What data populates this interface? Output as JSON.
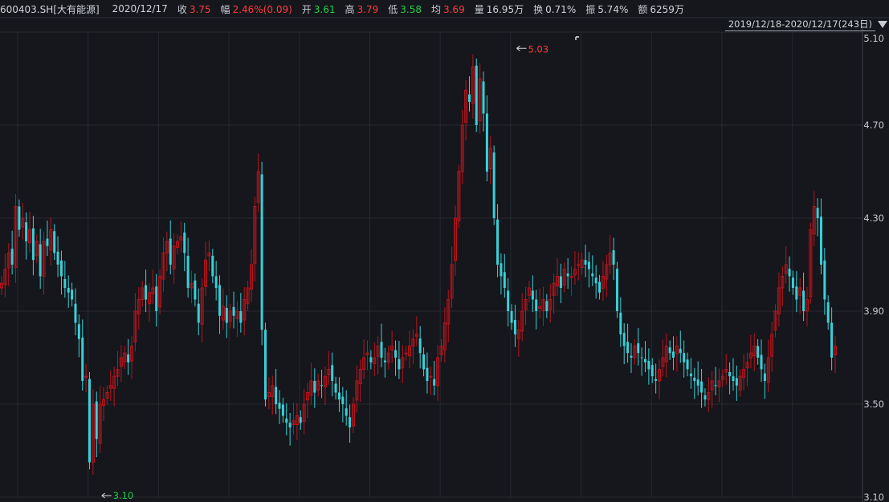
{
  "header": {
    "code": "600403.SH[大有能源]",
    "date": "2020/12/17",
    "close": {
      "label": "收",
      "value": "3.75"
    },
    "change": {
      "label": "幅",
      "value": "2.46%(0.09)"
    },
    "open": {
      "label": "开",
      "value": "3.61"
    },
    "high": {
      "label": "高",
      "value": "3.79"
    },
    "low": {
      "label": "低",
      "value": "3.58"
    },
    "avg": {
      "label": "均",
      "value": "3.69"
    },
    "volume": {
      "label": "量",
      "value": "16.95万"
    },
    "turnover": {
      "label": "换",
      "value": "0.71%"
    },
    "amplitude": {
      "label": "振",
      "value": "5.74%"
    },
    "amount": {
      "label": "额",
      "value": "6259万"
    }
  },
  "range_label": "2019/12/18-2020/12/17(243日)",
  "colors": {
    "up": "#ff3b3b",
    "down": "#39d0d8",
    "up_candle": "#b8141c",
    "grid": "#262a31",
    "background": "#15171c"
  },
  "chart_data": {
    "type": "candlestick",
    "title": "",
    "period": "2019/12/18-2020/12/17",
    "y_ticks": [
      "3.10",
      "3.50",
      "3.90",
      "4.30",
      "4.70",
      "5.10"
    ],
    "ylim": [
      3.1,
      5.1
    ],
    "grid": true,
    "max_marker": {
      "value": "5.03",
      "index": 146
    },
    "min_marker": {
      "value": "3.10",
      "index": 28
    },
    "close_series": [
      4.02,
      4.08,
      4.15,
      4.1,
      4.35,
      4.25,
      4.3,
      4.2,
      4.25,
      4.12,
      4.2,
      4.05,
      4.2,
      4.18,
      4.25,
      4.15,
      4.1,
      4.05,
      4.0,
      3.98,
      3.95,
      3.85,
      3.78,
      3.6,
      3.62,
      3.25,
      3.5,
      3.35,
      3.5,
      3.52,
      3.55,
      3.58,
      3.62,
      3.65,
      3.7,
      3.72,
      3.68,
      3.75,
      3.9,
      3.95,
      4.0,
      3.95,
      3.98,
      4.0,
      3.9,
      4.05,
      4.15,
      4.2,
      4.1,
      4.18,
      4.2,
      4.22,
      4.15,
      4.0,
      4.02,
      3.95,
      3.85,
      4.0,
      4.12,
      4.15,
      4.05,
      4.0,
      3.88,
      3.92,
      3.85,
      3.9,
      3.88,
      3.9,
      3.85,
      3.95,
      4.0,
      4.1,
      4.35,
      4.5,
      3.82,
      3.52,
      3.55,
      3.58,
      3.5,
      3.48,
      3.45,
      3.42,
      3.4,
      3.43,
      3.45,
      3.42,
      3.5,
      3.55,
      3.6,
      3.55,
      3.6,
      3.58,
      3.62,
      3.65,
      3.6,
      3.55,
      3.52,
      3.5,
      3.45,
      3.4,
      3.5,
      3.6,
      3.65,
      3.7,
      3.72,
      3.68,
      3.7,
      3.75,
      3.7,
      3.68,
      3.72,
      3.75,
      3.7,
      3.65,
      3.7,
      3.72,
      3.75,
      3.78,
      3.8,
      3.72,
      3.65,
      3.6,
      3.62,
      3.58,
      3.7,
      3.75,
      3.85,
      3.95,
      4.1,
      4.3,
      4.5,
      4.7,
      4.85,
      4.8,
      4.95,
      4.7,
      4.9,
      4.75,
      4.5,
      4.6,
      4.3,
      4.1,
      4.05,
      4.0,
      3.9,
      3.85,
      3.8,
      3.82,
      3.9,
      3.95,
      4.0,
      3.95,
      3.9,
      3.92,
      3.95,
      3.9,
      3.95,
      4.02,
      4.05,
      4.0,
      4.08,
      4.05,
      4.05,
      4.08,
      4.1,
      4.12,
      4.1,
      4.08,
      4.05,
      4.02,
      3.98,
      4.05,
      4.1,
      4.15,
      4.1,
      3.9,
      3.8,
      3.75,
      3.72,
      3.7,
      3.75,
      3.72,
      3.7,
      3.68,
      3.65,
      3.62,
      3.6,
      3.65,
      3.7,
      3.75,
      3.72,
      3.7,
      3.75,
      3.72,
      3.68,
      3.65,
      3.62,
      3.6,
      3.58,
      3.55,
      3.52,
      3.55,
      3.6,
      3.58,
      3.6,
      3.62,
      3.65,
      3.62,
      3.6,
      3.58,
      3.62,
      3.65,
      3.68,
      3.72,
      3.75,
      3.7,
      3.65,
      3.6,
      3.7,
      3.8,
      3.9,
      4.0,
      4.05,
      4.1,
      4.05,
      4.0,
      3.95,
      4.0,
      3.9,
      3.95,
      4.25,
      4.35,
      4.3,
      4.1,
      3.95,
      3.85,
      3.7,
      3.75
    ]
  }
}
